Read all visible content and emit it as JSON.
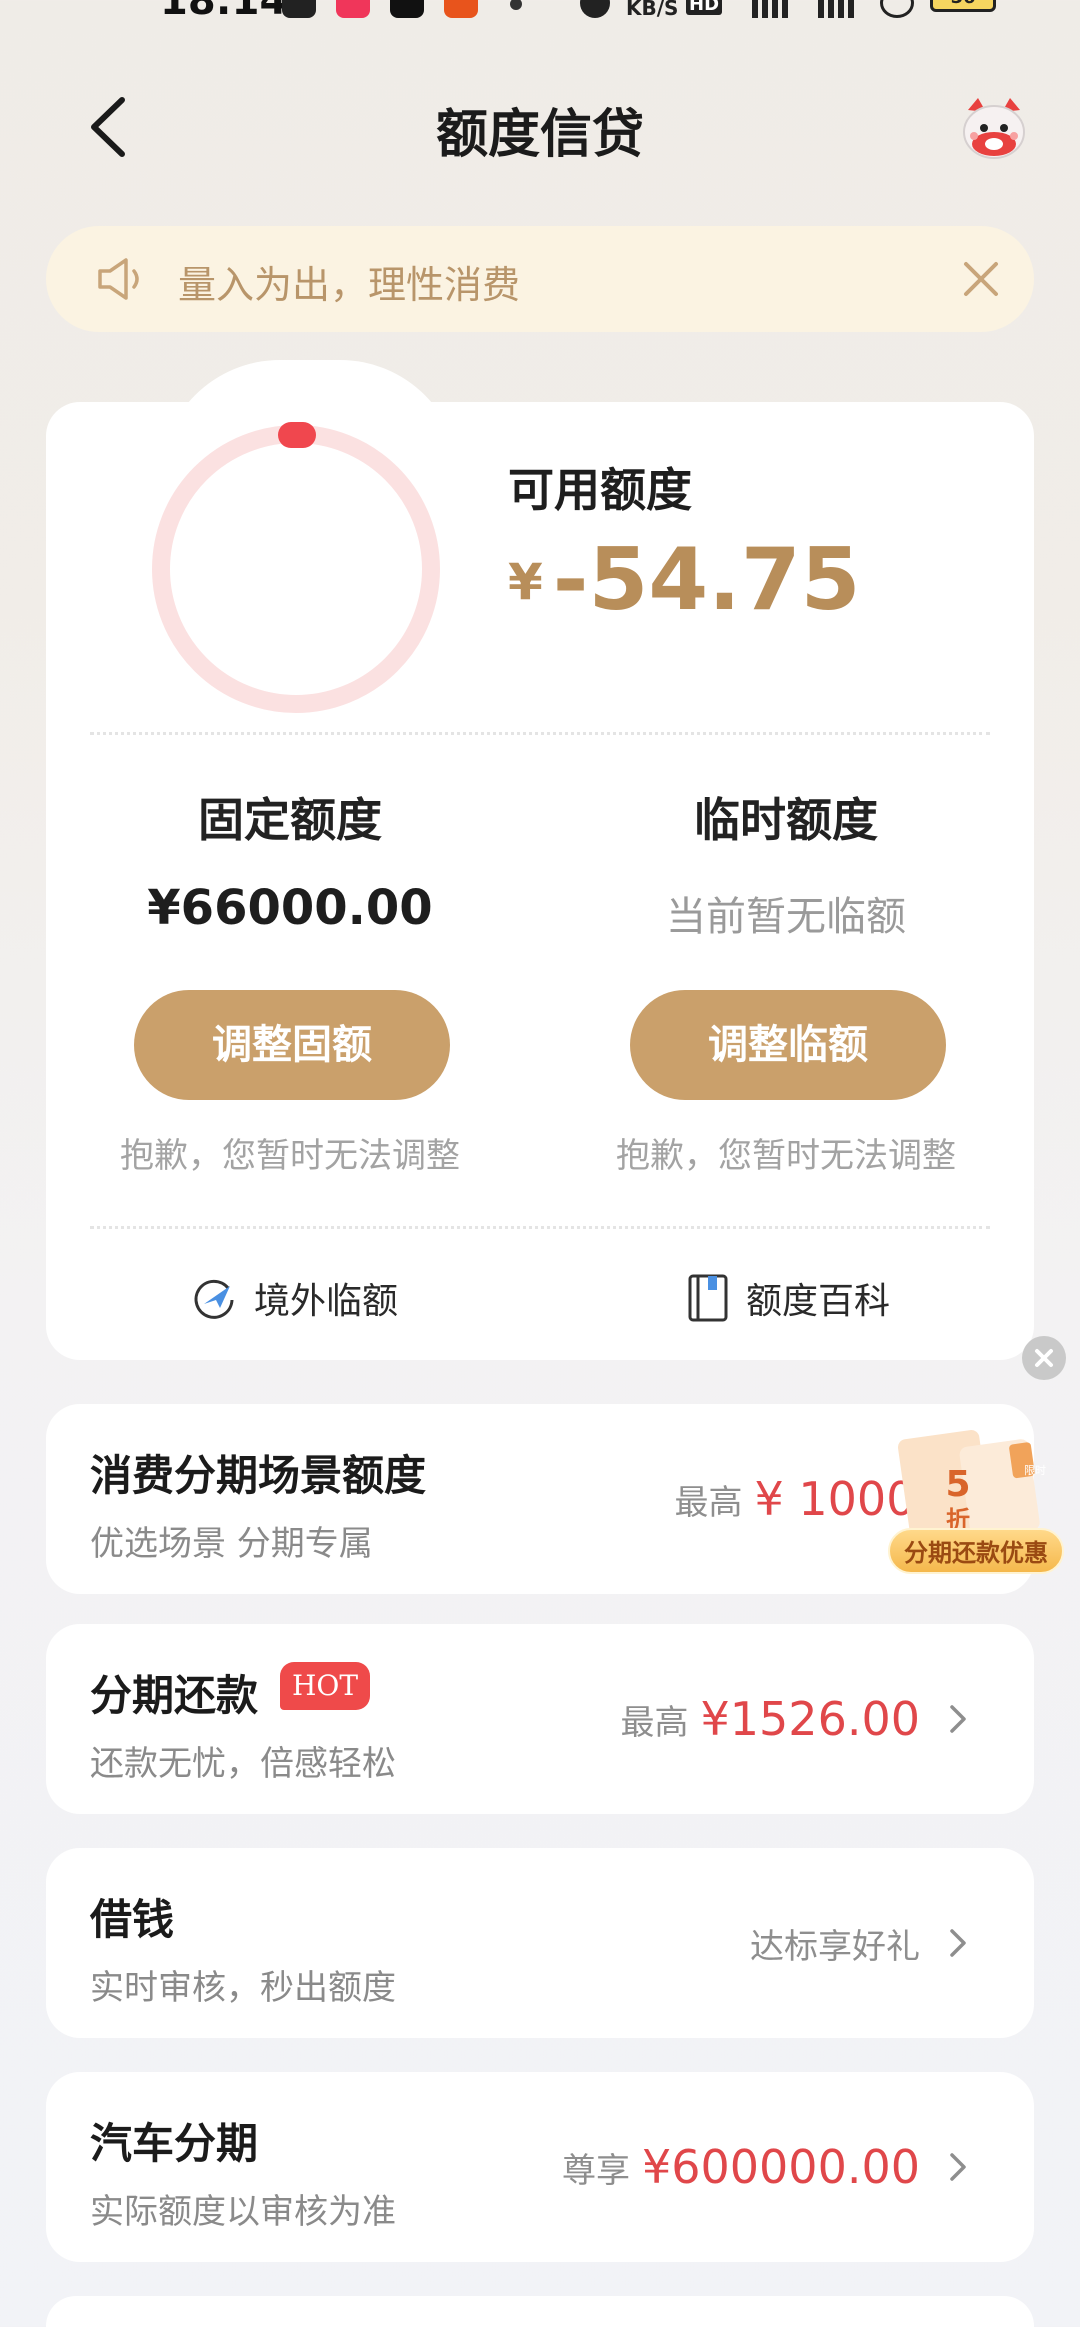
{
  "status_bar": {
    "time": "18:14",
    "speed_unit": "KB/S",
    "network_badge": "HD",
    "battery": "56"
  },
  "header": {
    "title": "额度信贷",
    "back_icon": "chevron-left-icon",
    "mascot_icon": "mascot-icon"
  },
  "notice": {
    "text": "量入为出，理性消费",
    "icon": "speaker-icon",
    "close_icon": "close-icon"
  },
  "quota": {
    "available_label": "可用额度",
    "currency_symbol": "¥",
    "available_value": "-54.75",
    "ring_progress": 0.0,
    "ring_color": "#f0474e",
    "fixed": {
      "title": "固定额度",
      "value": "¥66000.00",
      "button": "调整固额",
      "note": "抱歉，您暂时无法调整"
    },
    "temporary": {
      "title": "临时额度",
      "value": "当前暂无临额",
      "button": "调整临额",
      "note": "抱歉，您暂时无法调整"
    },
    "links": [
      {
        "label": "境外临额",
        "icon": "plane-globe-icon"
      },
      {
        "label": "额度百科",
        "icon": "book-icon"
      }
    ]
  },
  "rows": [
    {
      "title": "消费分期场景额度",
      "subtitle": "优选场景 分期专属",
      "prefix": "最高",
      "amount": "¥ 100000",
      "promo": {
        "number": "5",
        "unit": "折",
        "label": "分期还款优惠",
        "side_text": "限时"
      }
    },
    {
      "title": "分期还款",
      "badge": "HOT",
      "subtitle": "还款无忧，倍感轻松",
      "prefix": "最高",
      "amount": "¥1526.00"
    },
    {
      "title": "借钱",
      "subtitle": "实时审核，秒出额度",
      "right_text": "达标享好礼"
    },
    {
      "title": "汽车分期",
      "subtitle": "实际额度以审核为准",
      "prefix": "尊享",
      "amount": "¥600000.00"
    }
  ],
  "colors": {
    "accent_gold": "#caa06b",
    "amount_red": "#e0474a",
    "hot_red": "#ef4a4a"
  }
}
